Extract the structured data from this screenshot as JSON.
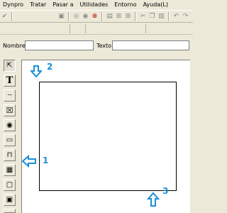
{
  "menu": [
    "Dynpro",
    "Tratar",
    "Pasar a",
    "Utilidades",
    "Entorno",
    "Ayuda(L)"
  ],
  "menu_underline": [
    "D",
    "T",
    "P",
    "U",
    "E",
    ""
  ],
  "fields": {
    "nombre_label": "Nombre",
    "nombre_value": "",
    "texto_label": "Texto",
    "texto_value": ""
  },
  "tools": [
    {
      "name": "pointer",
      "active": true
    },
    {
      "name": "text-field",
      "active": false
    },
    {
      "name": "input-field",
      "active": false
    },
    {
      "name": "checkbox",
      "active": false
    },
    {
      "name": "radio-button",
      "active": false
    },
    {
      "name": "pushbutton",
      "active": false
    },
    {
      "name": "tabstrip",
      "active": false
    },
    {
      "name": "box",
      "active": false
    },
    {
      "name": "subscreen",
      "active": false
    },
    {
      "name": "table-control",
      "active": false
    },
    {
      "name": "table-grid",
      "active": false
    }
  ],
  "callouts": {
    "one": "1",
    "two": "2",
    "three": "3"
  },
  "accent_color": "#1a8fd6"
}
